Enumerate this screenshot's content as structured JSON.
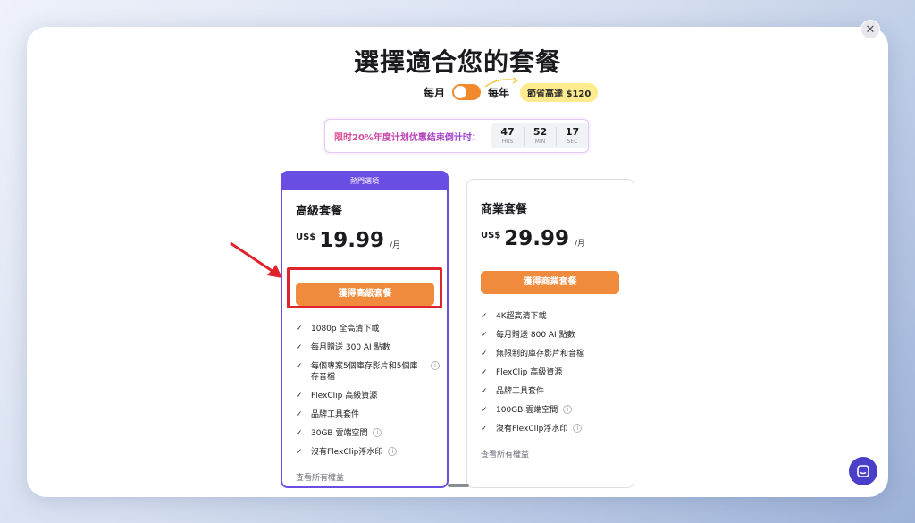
{
  "modal": {
    "title": "選擇適合您的套餐",
    "close_glyph": "✕"
  },
  "billing": {
    "monthly_label": "每月",
    "yearly_label": "每年",
    "toggle_state": "monthly",
    "save_badge": "節省高達 $120"
  },
  "countdown": {
    "text": "限时20%年度计划优惠结束倒计时：",
    "hours": "47",
    "hours_label": "HRS",
    "minutes": "52",
    "minutes_label": "MIN",
    "seconds": "17",
    "seconds_label": "SEC"
  },
  "plans": [
    {
      "ribbon": "熱門選項",
      "name": "高級套餐",
      "currency": "US$",
      "price": "19.99",
      "period": "/月",
      "cta": "獲得高級套餐",
      "features": [
        {
          "text": "1080p 全高清下載",
          "info": false
        },
        {
          "text": "每月贈送 300 AI 點數",
          "info": false
        },
        {
          "text": "每個專案5個庫存影片和5個庫存音檔",
          "info": true
        },
        {
          "text": "FlexClip 高級資源",
          "info": false
        },
        {
          "text": "品牌工具套件",
          "info": false
        },
        {
          "text": "30GB 雲端空間",
          "info": true
        },
        {
          "text": "沒有FlexClip浮水印",
          "info": true
        }
      ],
      "view_all": "查看所有權益"
    },
    {
      "name": "商業套餐",
      "currency": "US$",
      "price": "29.99",
      "period": "/月",
      "cta": "獲得商業套餐",
      "features": [
        {
          "text": "4K超高清下載",
          "info": false
        },
        {
          "text": "每月贈送 800 AI 點數",
          "info": false
        },
        {
          "text": "無限制的庫存影片和音檔",
          "info": false
        },
        {
          "text": "FlexClip 高級資源",
          "info": false
        },
        {
          "text": "品牌工具套件",
          "info": false
        },
        {
          "text": "100GB 雲端空間",
          "info": true
        },
        {
          "text": "沒有FlexClip浮水印",
          "info": true
        }
      ],
      "view_all": "查看所有權益"
    }
  ],
  "icons": {
    "check": "check-icon",
    "info": "info-icon",
    "chat": "chat-icon",
    "close": "close-icon"
  },
  "colors": {
    "accent_orange": "#f08a3c",
    "premium_purple": "#6a4de3",
    "annotation_red": "#e0242e",
    "badge_yellow": "#fdeb8d"
  }
}
